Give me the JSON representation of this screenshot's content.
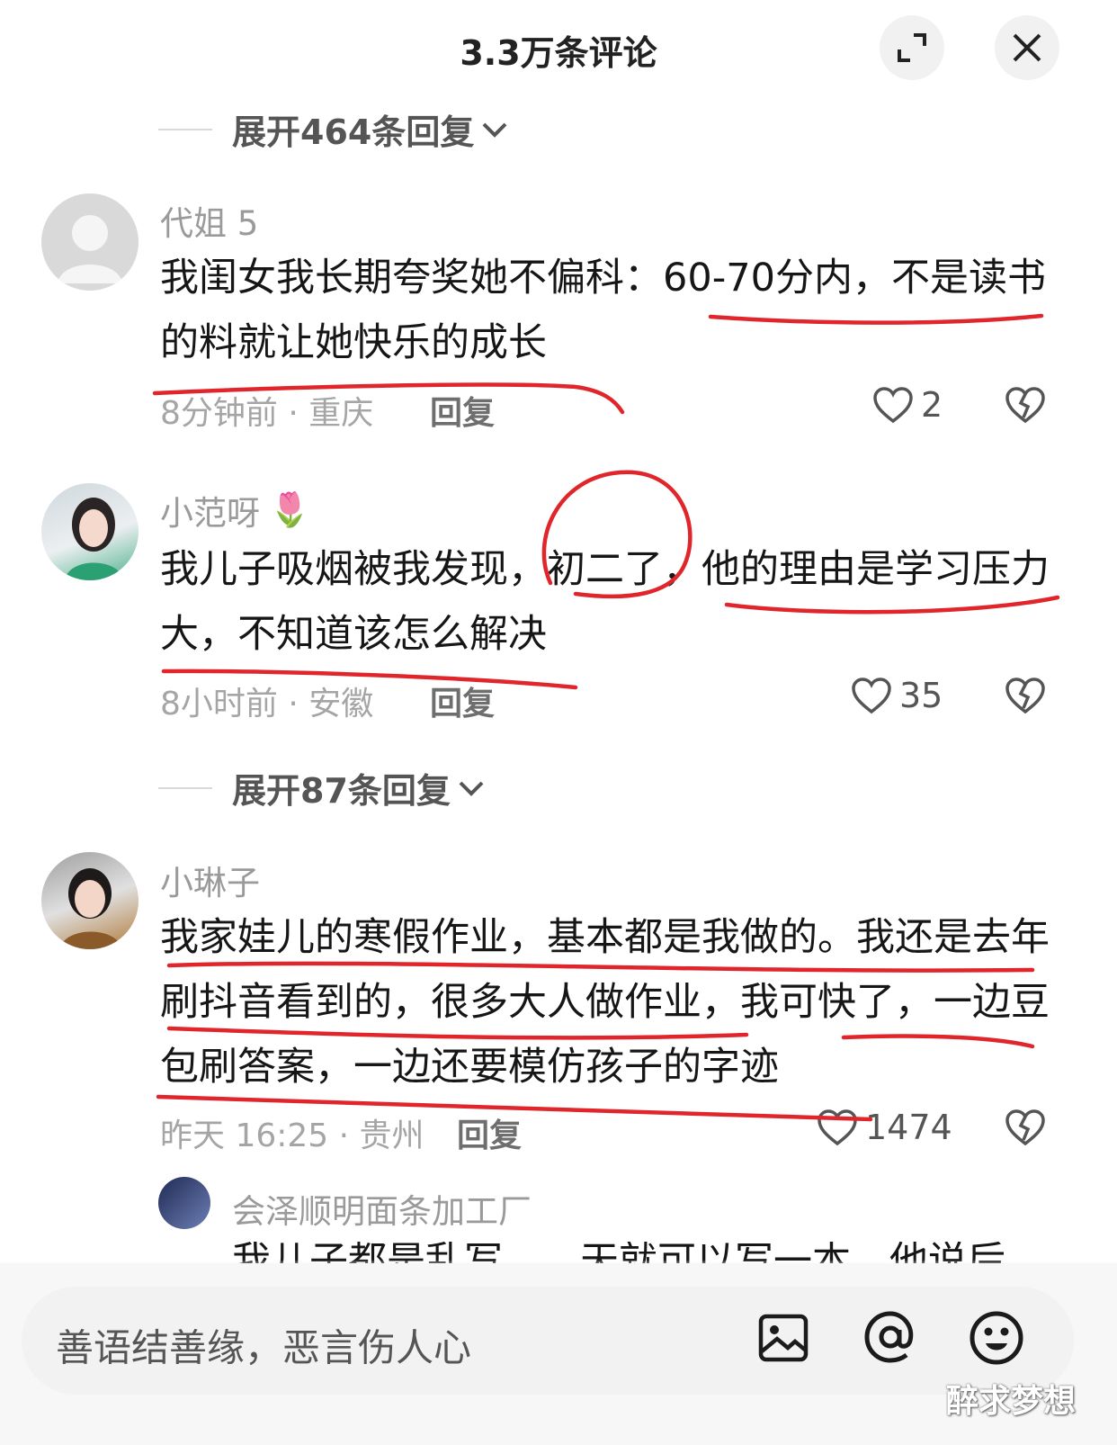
{
  "header": {
    "title": "3.3万条评论",
    "expand_icon": "expand-icon",
    "close_icon": "close-icon"
  },
  "expand_rows": [
    {
      "label": "展开464条回复"
    },
    {
      "label": "展开87条回复"
    }
  ],
  "comments": [
    {
      "username": "代姐 5",
      "avatar": "default-avatar",
      "text": "我闺女我长期夸奖她不偏科：60-70分内，不是读书的料就让她快乐的成长",
      "meta": "8分钟前 · 重庆",
      "reply_label": "回复",
      "likes": "2"
    },
    {
      "username": "小范呀",
      "emoji": "🌷",
      "avatar": "user-photo",
      "text": "我儿子吸烟被我发现，初二了，他的理由是学习压力大，不知道该怎么解决",
      "meta": "8小时前 · 安徽",
      "reply_label": "回复",
      "likes": "35"
    },
    {
      "username": "小琳子",
      "avatar": "user-photo",
      "text": "我家娃儿的寒假作业，基本都是我做的。我还是去年刷抖音看到的，很多大人做作业，我可快了，一边豆包刷答案，一边还要模仿孩子的字迹",
      "meta": "昨天 16:25 · 贵州",
      "reply_label": "回复",
      "likes": "1474"
    }
  ],
  "sub_reply": {
    "username": "会泽顺明面条加工厂",
    "partial_text": "我儿子都是乱写……天就可以写一本，他说后"
  },
  "input": {
    "placeholder": "善语结善缘，恶言伤人心",
    "image_icon": "image-icon",
    "at_icon": "at-icon",
    "emoji_icon": "emoji-icon"
  },
  "watermark": "醉求梦想",
  "colors": {
    "annotation_red": "#e0262b"
  }
}
